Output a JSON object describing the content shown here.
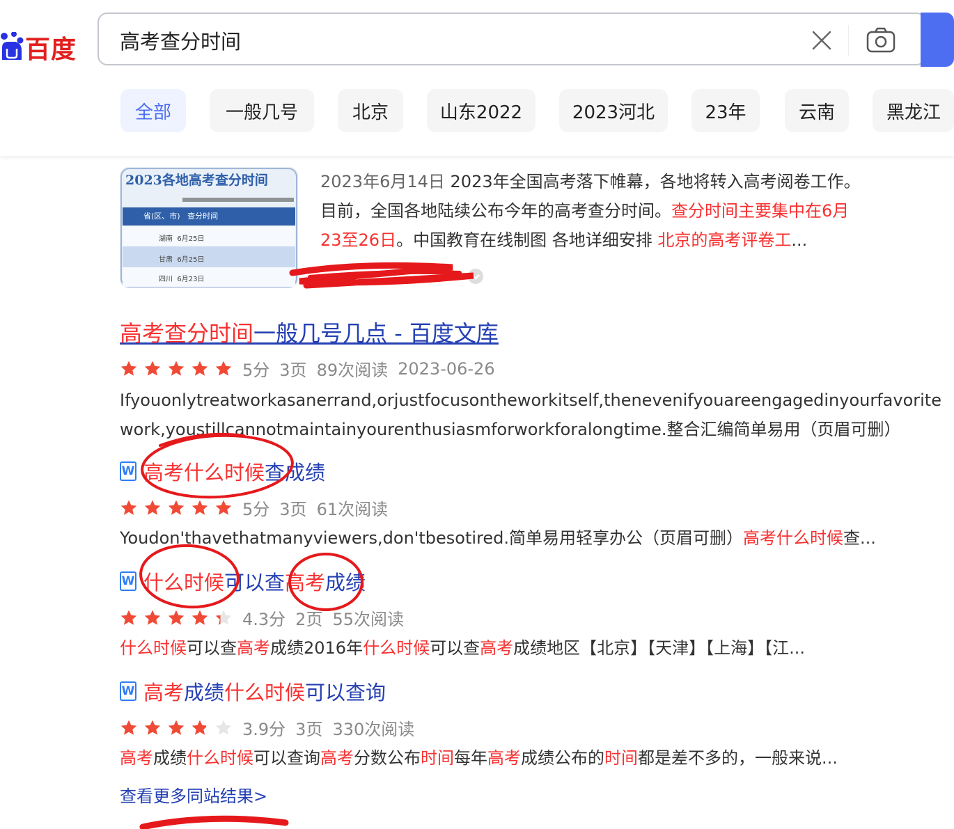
{
  "header": {
    "logo_text": "百度",
    "search_value": "高考查分时间",
    "tabs": [
      {
        "label": "全部",
        "active": true
      },
      {
        "label": "一般几号"
      },
      {
        "label": "北京"
      },
      {
        "label": "山东2022"
      },
      {
        "label": "2023河北"
      },
      {
        "label": "23年"
      },
      {
        "label": "云南"
      },
      {
        "label": "黑龙江"
      }
    ]
  },
  "featured": {
    "image_title": "2023各地高考查分时间",
    "image_header": "省(区、市)   查分时间",
    "image_rows": [
      "湖南  6月25日",
      "甘肃  6月25日",
      "四川  6月23日"
    ],
    "date": "2023年6月14日",
    "text_1": "2023年全国高考落下帷幕，各地将转入高考阅卷工作。",
    "text_2": "目前，全国各地陆续公布今年的高考查分时间。",
    "text_hl_1": "查分时间主要集中在6月",
    "text_hl_2": "23至26日",
    "text_3": "。中国教育在线制图 各地详细安排 ",
    "text_hl_3": "北京的高考评卷工",
    "text_ellipsis": "..."
  },
  "wenku": {
    "title_hl": "高考查分时间",
    "title_rest": "一般几号几点 - 百度文库",
    "rating": 5,
    "meta": {
      "score": "5分",
      "pages": "3页",
      "reads": "89次阅读",
      "date": "2023-06-26"
    },
    "desc_1": "Ifyouonlytreatworkasanerrand,orjustfocusontheworkitself,thenevenifyouareengagedinyourfavorite",
    "desc_2": "work,youstillcannotmaintainyourenthusiasmforworkforalongtime.整合汇编简单易用（页眉可删）",
    "docs": [
      {
        "icon": "W",
        "title_parts": [
          {
            "t": "高考什么时候",
            "hl": true
          },
          {
            "t": "查成绩",
            "hl": false
          }
        ],
        "rating": 5,
        "meta": {
          "score": "5分",
          "pages": "3页",
          "reads": "61次阅读"
        },
        "snippet_parts": [
          {
            "t": "Youdon'thavethatmanyviewers,don'tbesotired.简单易用轻享办公（页眉可删）",
            "hl": false
          },
          {
            "t": "高考什么时候",
            "hl": true
          },
          {
            "t": "查...",
            "hl": false
          }
        ]
      },
      {
        "icon": "W",
        "title_parts": [
          {
            "t": "什么时候",
            "hl": true
          },
          {
            "t": "可以查",
            "hl": false
          },
          {
            "t": "高考",
            "hl": true
          },
          {
            "t": "成绩",
            "hl": false
          }
        ],
        "rating": 4.3,
        "meta": {
          "score": "4.3分",
          "pages": "2页",
          "reads": "55次阅读"
        },
        "snippet_parts": [
          {
            "t": "什么时候",
            "hl": true
          },
          {
            "t": "可以查",
            "hl": false
          },
          {
            "t": "高考",
            "hl": true
          },
          {
            "t": "成绩2016年",
            "hl": false
          },
          {
            "t": "什么时候",
            "hl": true
          },
          {
            "t": "可以查",
            "hl": false
          },
          {
            "t": "高考",
            "hl": true
          },
          {
            "t": "成绩地区【北京】【天津】【上海】【江...",
            "hl": false
          }
        ]
      },
      {
        "icon": "W",
        "title_parts": [
          {
            "t": "高考",
            "hl": true
          },
          {
            "t": "成绩",
            "hl": false
          },
          {
            "t": "什么时候",
            "hl": true
          },
          {
            "t": "可以查询",
            "hl": false
          }
        ],
        "rating": 3.9,
        "meta": {
          "score": "3.9分",
          "pages": "3页",
          "reads": "330次阅读"
        },
        "snippet_parts": [
          {
            "t": "高考",
            "hl": true
          },
          {
            "t": "成绩",
            "hl": false
          },
          {
            "t": "什么时候",
            "hl": true
          },
          {
            "t": "可以查询",
            "hl": false
          },
          {
            "t": "高考",
            "hl": true
          },
          {
            "t": "分数公布",
            "hl": false
          },
          {
            "t": "时间",
            "hl": true
          },
          {
            "t": "每年",
            "hl": false
          },
          {
            "t": "高考",
            "hl": true
          },
          {
            "t": "成绩公布的",
            "hl": false
          },
          {
            "t": "时间",
            "hl": true
          },
          {
            "t": "都是差不多的，一般来说...",
            "hl": false
          }
        ]
      }
    ],
    "more_link": "查看更多同站结果>"
  },
  "colors": {
    "brand_red": "#e1201f",
    "brand_blue": "#4e6ef2",
    "link_blue": "#2440b3",
    "highlight_red": "#f73131",
    "star": "#f04a36",
    "annotation_red": "#e5191c"
  }
}
